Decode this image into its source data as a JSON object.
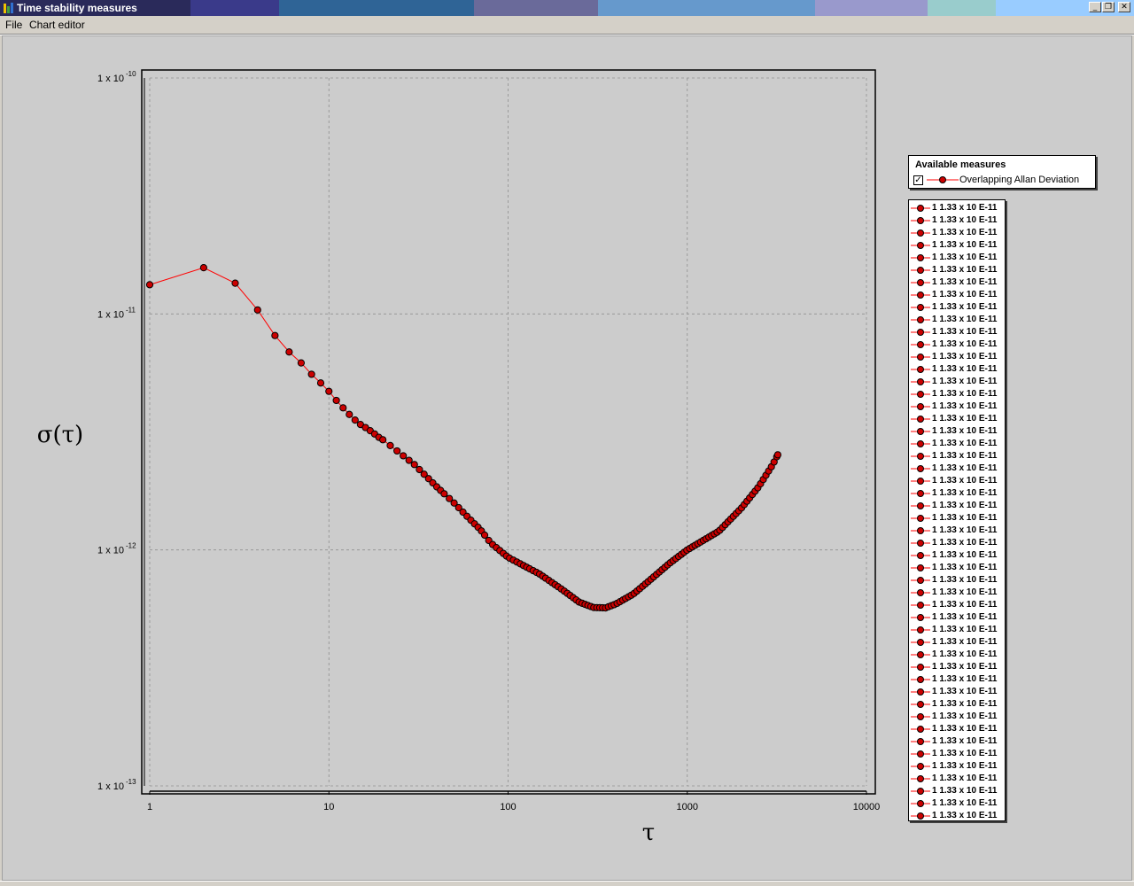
{
  "window": {
    "title": "Time stability measures",
    "titlebar_colors": [
      "#2a2a5a",
      "#3a3a8a",
      "#2f6496",
      "#6a6a9a",
      "#6699cc",
      "#9999cc",
      "#99cccc",
      "#99ccff"
    ],
    "buttons": {
      "minimize": "_",
      "restore": "❐",
      "close": "✕"
    }
  },
  "menu": {
    "file": "File",
    "chart_editor": "Chart editor"
  },
  "legend": {
    "title": "Available measures",
    "checked": true,
    "check_mark": "✓",
    "series_label": "Overlapping Allan Deviation",
    "series_color": "#ff0000"
  },
  "values_list": {
    "item_label": "1 1.33 x 10 E-11",
    "count": 50
  },
  "chart_data": {
    "type": "line",
    "xscale": "log",
    "yscale": "log",
    "xlim": [
      1,
      10000
    ],
    "ylim": [
      1e-13,
      1e-10
    ],
    "xlabel": "τ",
    "ylabel": "σ(τ)",
    "x_ticks": [
      "1",
      "10",
      "100",
      "1000",
      "10000"
    ],
    "y_ticks": [
      {
        "base": "1 x 10",
        "exp": "-10"
      },
      {
        "base": "1 x 10",
        "exp": "-11"
      },
      {
        "base": "1 x 10",
        "exp": "-12"
      },
      {
        "base": "1 x 10",
        "exp": "-13"
      }
    ],
    "grid": true,
    "series": [
      {
        "color": "#ff0000",
        "marker": "circle",
        "points": [
          [
            1,
            1.33e-11
          ],
          [
            2,
            1.57e-11
          ],
          [
            3,
            1.35e-11
          ],
          [
            4,
            1.04e-11
          ],
          [
            5,
            8.1e-12
          ],
          [
            6,
            6.9e-12
          ],
          [
            7,
            6.2e-12
          ],
          [
            8,
            5.55e-12
          ],
          [
            9,
            5.1e-12
          ],
          [
            10,
            4.7e-12
          ],
          [
            11,
            4.3e-12
          ],
          [
            12,
            4e-12
          ],
          [
            13,
            3.75e-12
          ],
          [
            14,
            3.55e-12
          ],
          [
            15,
            3.4e-12
          ],
          [
            16,
            3.3e-12
          ],
          [
            17,
            3.2e-12
          ],
          [
            18,
            3.1e-12
          ],
          [
            19,
            3e-12
          ],
          [
            20,
            2.93e-12
          ],
          [
            30,
            2.3e-12
          ],
          [
            40,
            1.85e-12
          ],
          [
            50,
            1.58e-12
          ],
          [
            60,
            1.37e-12
          ],
          [
            70,
            1.22e-12
          ],
          [
            80,
            1.07e-12
          ],
          [
            100,
            9.3e-13
          ],
          [
            150,
            7.9e-13
          ],
          [
            200,
            6.8e-13
          ],
          [
            250,
            6e-13
          ],
          [
            300,
            5.7e-13
          ],
          [
            350,
            5.68e-13
          ],
          [
            400,
            5.9e-13
          ],
          [
            500,
            6.5e-13
          ],
          [
            600,
            7.3e-13
          ],
          [
            800,
            8.8e-13
          ],
          [
            1000,
            1e-12
          ],
          [
            1500,
            1.2e-12
          ],
          [
            2000,
            1.5e-12
          ],
          [
            2500,
            1.85e-12
          ],
          [
            3000,
            2.3e-12
          ],
          [
            3200,
            2.53e-12
          ]
        ]
      }
    ]
  }
}
